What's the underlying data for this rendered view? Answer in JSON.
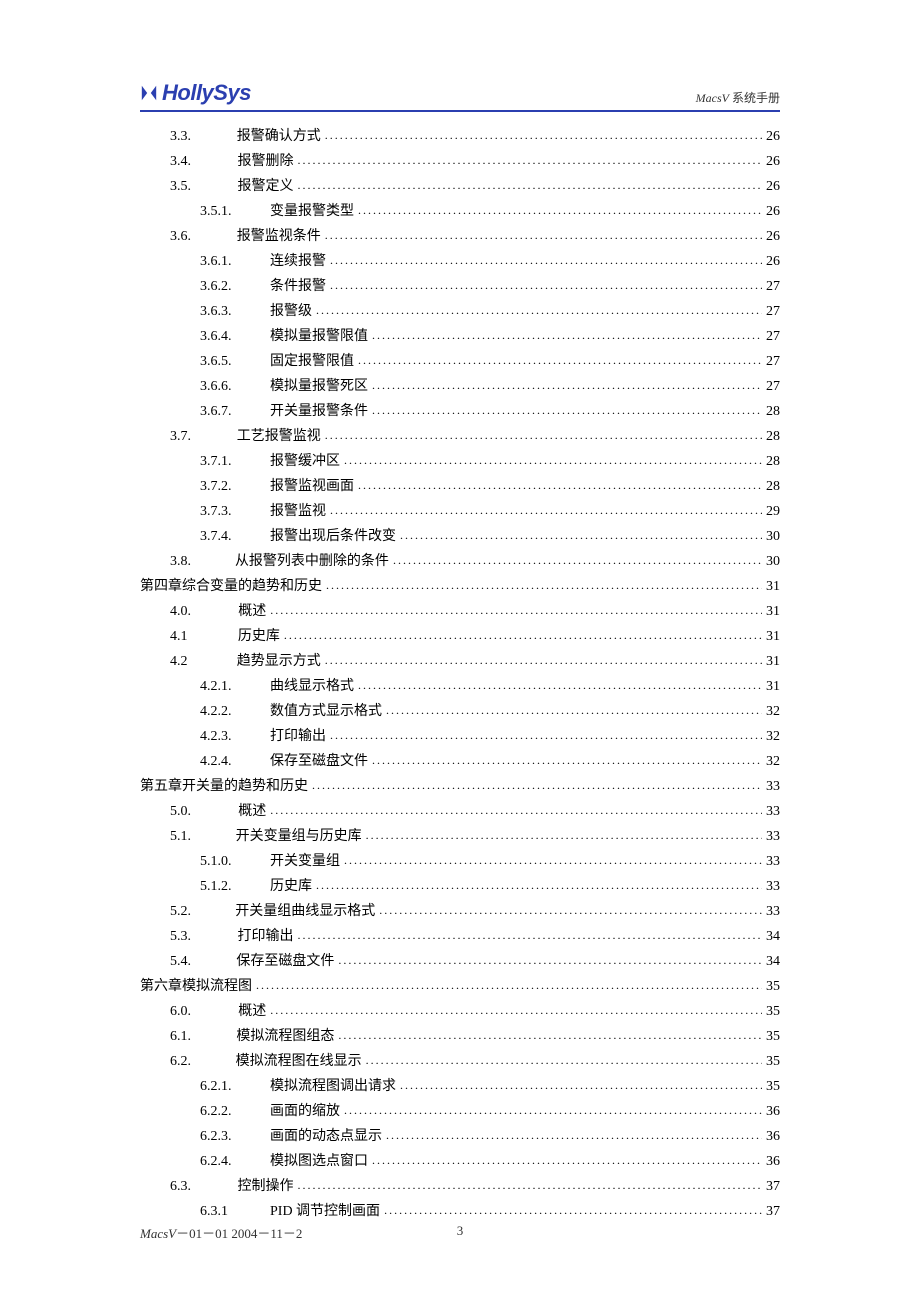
{
  "header": {
    "logo_text": "HollySys",
    "right_text_prefix": "MacsV",
    "right_text_suffix": " 系统手册"
  },
  "toc": [
    {
      "lvl": 1,
      "num": "3.3.",
      "title": "报警确认方式",
      "page": "26"
    },
    {
      "lvl": 1,
      "num": "3.4.",
      "title": "报警删除",
      "page": "26"
    },
    {
      "lvl": 1,
      "num": "3.5.",
      "title": "报警定义",
      "page": "26"
    },
    {
      "lvl": 2,
      "num": "3.5.1.",
      "title": "变量报警类型",
      "page": "26"
    },
    {
      "lvl": 1,
      "num": "3.6.",
      "title": "报警监视条件",
      "page": "26"
    },
    {
      "lvl": 2,
      "num": "3.6.1.",
      "title": "连续报警",
      "page": "26"
    },
    {
      "lvl": 2,
      "num": "3.6.2.",
      "title": "条件报警",
      "page": "27"
    },
    {
      "lvl": 2,
      "num": "3.6.3.",
      "title": "报警级",
      "page": "27"
    },
    {
      "lvl": 2,
      "num": "3.6.4.",
      "title": "模拟量报警限值",
      "page": "27"
    },
    {
      "lvl": 2,
      "num": "3.6.5.",
      "title": "固定报警限值",
      "page": "27"
    },
    {
      "lvl": 2,
      "num": "3.6.6.",
      "title": "模拟量报警死区",
      "page": "27"
    },
    {
      "lvl": 2,
      "num": "3.6.7.",
      "title": "开关量报警条件",
      "page": "28"
    },
    {
      "lvl": 1,
      "num": "3.7.",
      "title": "工艺报警监视",
      "page": "28"
    },
    {
      "lvl": 2,
      "num": "3.7.1.",
      "title": "报警缓冲区",
      "page": "28"
    },
    {
      "lvl": 2,
      "num": "3.7.2.",
      "title": "报警监视画面",
      "page": "28"
    },
    {
      "lvl": 2,
      "num": "3.7.3.",
      "title": "报警监视",
      "page": "29"
    },
    {
      "lvl": 2,
      "num": "3.7.4.",
      "title": "报警出现后条件改变",
      "page": "30"
    },
    {
      "lvl": 1,
      "num": "3.8.",
      "title": "从报警列表中删除的条件",
      "page": "30"
    },
    {
      "lvl": 0,
      "num": "第四章",
      "title": "  综合变量的趋势和历史",
      "page": "31"
    },
    {
      "lvl": 1,
      "num": "4.0.",
      "title": "概述",
      "page": "31"
    },
    {
      "lvl": 1,
      "num": "4.1",
      "title": "历史库",
      "page": "31"
    },
    {
      "lvl": 1,
      "num": "4.2",
      "title": "趋势显示方式",
      "page": "31"
    },
    {
      "lvl": 2,
      "num": "4.2.1.",
      "title": "曲线显示格式",
      "page": "31"
    },
    {
      "lvl": 2,
      "num": "4.2.2.",
      "title": "数值方式显示格式",
      "page": "32"
    },
    {
      "lvl": 2,
      "num": "4.2.3.",
      "title": "打印输出",
      "page": "32"
    },
    {
      "lvl": 2,
      "num": "4.2.4.",
      "title": "保存至磁盘文件",
      "page": "32"
    },
    {
      "lvl": 0,
      "num": "第五章",
      "title": "  开关量的趋势和历史",
      "page": "33"
    },
    {
      "lvl": 1,
      "num": "5.0.",
      "title": "概述",
      "page": "33"
    },
    {
      "lvl": 1,
      "num": "5.1.",
      "title": "开关变量组与历史库",
      "page": "33"
    },
    {
      "lvl": 2,
      "num": "5.1.0.",
      "title": "开关变量组",
      "page": "33"
    },
    {
      "lvl": 2,
      "num": "5.1.2.",
      "title": "历史库",
      "page": "33"
    },
    {
      "lvl": 1,
      "num": "5.2.",
      "title": "开关量组曲线显示格式",
      "page": "33"
    },
    {
      "lvl": 1,
      "num": "5.3.",
      "title": "打印输出",
      "page": "34"
    },
    {
      "lvl": 1,
      "num": "5.4.",
      "title": "保存至磁盘文件",
      "page": "34"
    },
    {
      "lvl": 0,
      "num": "第六章",
      "title": "  模拟流程图",
      "page": "35"
    },
    {
      "lvl": 1,
      "num": "6.0.",
      "title": "概述",
      "page": "35"
    },
    {
      "lvl": 1,
      "num": "6.1.",
      "title": "模拟流程图组态",
      "page": "35"
    },
    {
      "lvl": 1,
      "num": "6.2.",
      "title": "模拟流程图在线显示",
      "page": "35"
    },
    {
      "lvl": 2,
      "num": "6.2.1.",
      "title": "模拟流程图调出请求",
      "page": "35"
    },
    {
      "lvl": 2,
      "num": "6.2.2.",
      "title": "画面的缩放",
      "page": "36"
    },
    {
      "lvl": 2,
      "num": "6.2.3.",
      "title": "画面的动态点显示",
      "page": "36"
    },
    {
      "lvl": 2,
      "num": "6.2.4.",
      "title": "模拟图选点窗口",
      "page": "36"
    },
    {
      "lvl": 1,
      "num": "6.3.",
      "title": "控制操作",
      "page": "37"
    },
    {
      "lvl": 2,
      "num": "6.3.1",
      "title": "PID 调节控制画面",
      "page": "37"
    }
  ],
  "footer": {
    "left_prefix": "MacsV",
    "left_suffix": "－01－01  2004－11－2",
    "page_number": "3"
  }
}
